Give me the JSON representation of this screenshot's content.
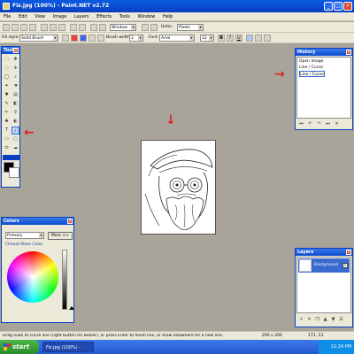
{
  "window": {
    "title": "Fiz.jpg (100%) - Paint.NET v2.72",
    "min": "_",
    "max": "□",
    "close": "×"
  },
  "menu": [
    "File",
    "Edit",
    "View",
    "Image",
    "Layers",
    "Effects",
    "Tools",
    "Window",
    "Help"
  ],
  "toolbar2": {
    "window_label": "Window",
    "units_label": "Units:",
    "units_value": "Pixels"
  },
  "toolbar3": {
    "fill_label": "Fill style:",
    "fill_value": "Solid Brush",
    "brush_label": "Brush width:",
    "brush_value": "2",
    "font_label": "Font:",
    "font_value": "Arial",
    "size_value": "12",
    "bold": "B",
    "italic": "I",
    "underline": "U"
  },
  "tools_panel": {
    "title": "Tools",
    "close": "×"
  },
  "history_panel": {
    "title": "History",
    "close": "×",
    "items": [
      "Open Image",
      "Line / Curve",
      "Line / Curve"
    ]
  },
  "colors_panel": {
    "title": "Colors",
    "close": "×",
    "mode_value": "Primary",
    "more_label": "More >>",
    "choose_label": "Choose Base Color"
  },
  "layers_panel": {
    "title": "Layers",
    "close": "×",
    "layer_name": "Background"
  },
  "status": {
    "hint": "Drag nubs to curve line (right button for Bezier), or press Enter to finish line, or draw elsewhere for a new line.",
    "image_size": "200 x 200",
    "cursor_pos": "171, 13"
  },
  "taskbar": {
    "start_label": "start",
    "task_label": "Fiz.jpg (100%) - Paint...",
    "clock": "11:24 PM"
  },
  "colors": {
    "primary": "#000000",
    "secondary": "#ffffff",
    "annotation_arrow": "#e02020"
  }
}
